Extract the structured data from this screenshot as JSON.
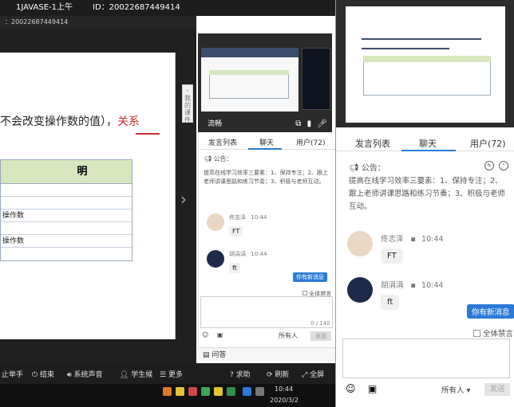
{
  "header": {
    "course_title": "1JAVASE-1上午",
    "room_id": "ID：20022687449414",
    "sub_id": "：20022687449414"
  },
  "slide": {
    "text_main": "不会改变操作数的值），",
    "text_highlight": "关系",
    "table_header": "明",
    "rows": [
      "",
      "",
      "操作数",
      "",
      "操作数",
      ""
    ],
    "collapse_tab": "我的课件"
  },
  "inner_video": {
    "quality_label": "流畅"
  },
  "chat": {
    "tabs": {
      "speakers": "发言列表",
      "chat": "聊天",
      "users": "用户(72)"
    },
    "notice_label": "公告：",
    "notice_text": "提高在线学习效率三要素：1、保持专注；2、跟上老师讲课思路和练习节奏；3、积极与老师互动。",
    "messages": [
      {
        "name": "佟志泽",
        "time": "10:44",
        "text": "FT"
      },
      {
        "name": "胡涓涓",
        "time": "10:44",
        "text": "ft"
      }
    ],
    "new_message_badge": "你有新消息",
    "all_mute": "全体禁言",
    "char_count": "0 / 140",
    "recipient": "所有人",
    "send_label": "发送",
    "qa_label": "问答"
  },
  "toolbar": {
    "items": [
      "止举手",
      "结束",
      "系统声音",
      "学生候",
      "更多",
      "求助",
      "刷新",
      "全屏"
    ]
  },
  "taskbar": {
    "time": "10:44",
    "date": "2020/3/2"
  },
  "colors": {
    "accent": "#2b7bd6",
    "highlight_red": "#c83030",
    "table_header_bg": "#d8e6bf"
  }
}
